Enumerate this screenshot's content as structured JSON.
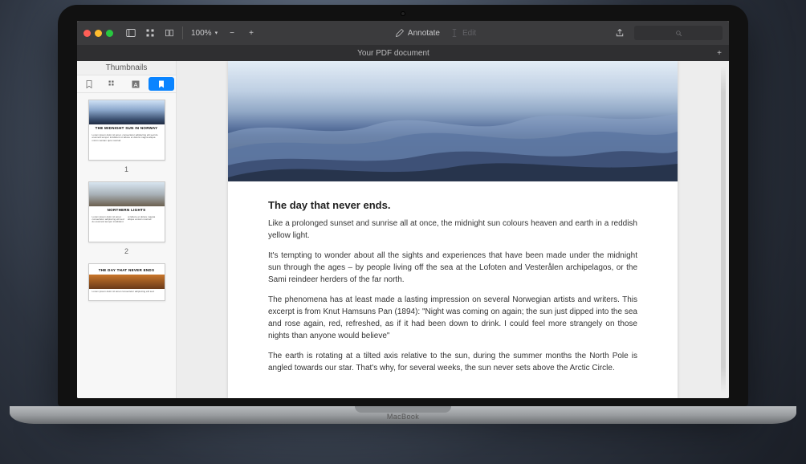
{
  "toolbar": {
    "zoom_label": "100%",
    "annotate_label": "Annotate",
    "edit_label": "Edit",
    "search_placeholder": ""
  },
  "tabbar": {
    "document_title": "Your PDF document"
  },
  "sidebar": {
    "header": "Thumbnails",
    "pages": [
      {
        "number": "1",
        "title": "THE MIDNIGHT SUN IN NORWAY"
      },
      {
        "number": "2",
        "title": "NORTHERN LIGHTS"
      },
      {
        "number": "",
        "title": "THE DAY THAT NEVER ENDS"
      }
    ]
  },
  "article": {
    "title": "The day that never ends.",
    "paragraphs": [
      "Like a prolonged sunset and sunrise all at once, the midnight sun colours heaven and earth in a reddish yellow light.",
      "It's tempting to wonder about all the sights and experiences that have been made under the midnight sun through the ages – by people living off the sea at the Lofoten and Vesterålen archipelagos, or the Sami reindeer herders of the far north.",
      "The phenomena has at least made a lasting impression on several Norwegian artists and writers. This excerpt is from Knut Hamsuns Pan (1894): \"Night was coming on again; the sun just dipped into the sea and rose again, red, refreshed, as if it had been down to drink. I could feel more strangely on those nights than anyone would believe\"",
      "The earth is rotating at a tilted axis relative to the sun, during the summer months the North Pole is angled towards our star. That's why, for several weeks, the sun never sets above the Arctic Circle."
    ]
  },
  "device": {
    "label": "MacBook"
  }
}
